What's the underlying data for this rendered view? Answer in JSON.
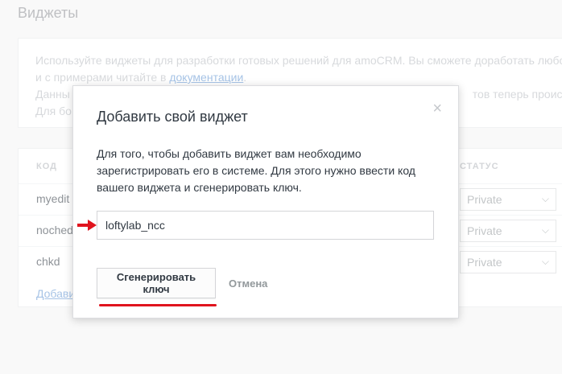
{
  "page": {
    "title": "Виджеты",
    "info": {
      "line1": "Используйте виджеты для разработки готовых решений для amoCRM. Вы сможете доработать любой",
      "line2_prefix": "и с примерами читайте в ",
      "line2_link": "документации",
      "line2_suffix": ".",
      "line3_start": "Данны",
      "line3_end": "тов теперь происходит",
      "line4_start": "Для бо"
    },
    "table": {
      "col_code": "КОД",
      "col_status": "СТАТУС",
      "rows": [
        {
          "code": "myedit",
          "status": "Private"
        },
        {
          "code": "noched",
          "status": "Private"
        },
        {
          "code": "chkd",
          "status": "Private"
        }
      ],
      "add_link": "Добави"
    }
  },
  "modal": {
    "title": "Добавить свой виджет",
    "close_symbol": "×",
    "description": "Для того, чтобы добавить виджет вам необходимо зарегистрировать его в системе. Для этого нужно ввести код вашего виджета и сгенерировать ключ.",
    "input_value": "loftylab_ncc",
    "generate_label": "Сгенерировать ключ",
    "cancel_label": "Отмена"
  },
  "annotations": {
    "arrow_color": "#e0141e",
    "underline_color": "#e0141e"
  }
}
